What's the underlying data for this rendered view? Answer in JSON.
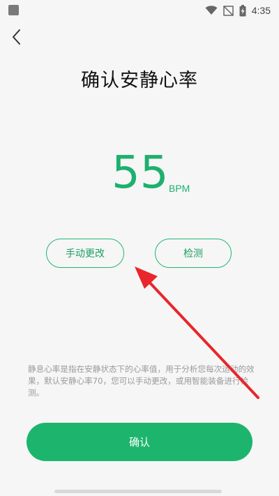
{
  "status_bar": {
    "time": "4:35",
    "icons": [
      "wifi-icon",
      "no-signal-icon",
      "battery-charging-icon"
    ]
  },
  "header": {
    "back_icon": "chevron-left-icon",
    "title": "确认安静心率"
  },
  "heart_rate": {
    "value": "55",
    "unit": "BPM"
  },
  "actions": {
    "manual_label": "手动更改",
    "detect_label": "检测"
  },
  "description": "静息心率是指在安静状态下的心率值，用于分析您每次运动的效果，默认安静心率70，您可以手动更改，或用智能装备进行检测。",
  "confirm_label": "确认",
  "colors": {
    "accent": "#1db56d",
    "annotation_arrow": "#e8262b",
    "background": "#f6f6f6"
  }
}
